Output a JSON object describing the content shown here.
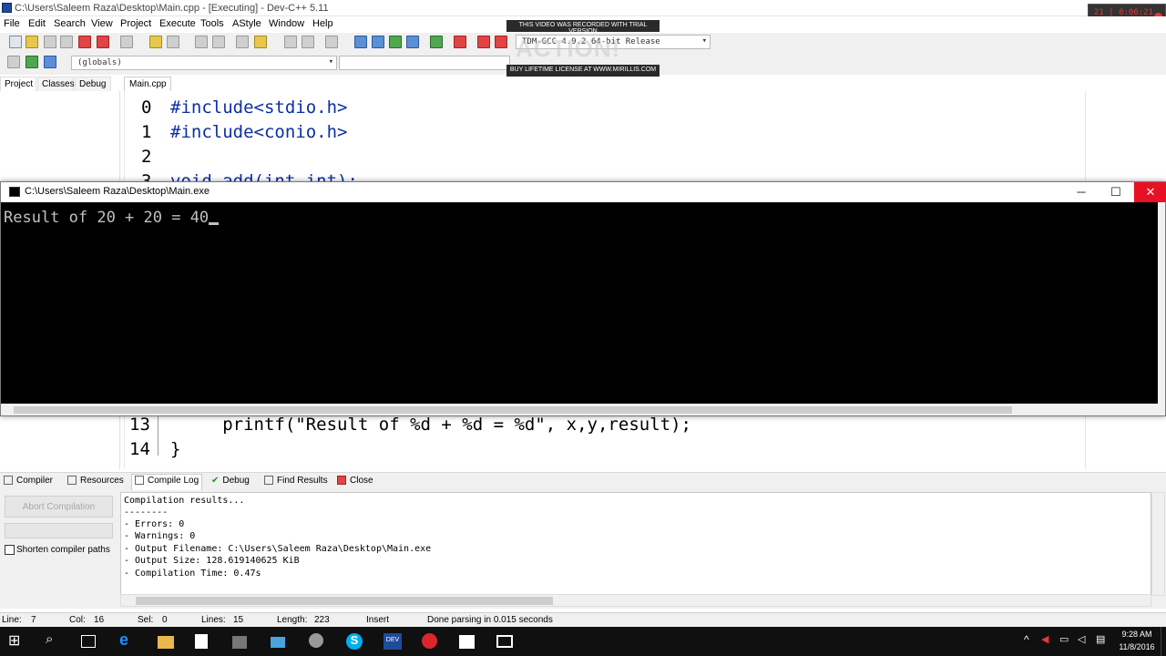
{
  "ide": {
    "title": "C:\\Users\\Saleem Raza\\Desktop\\Main.cpp - [Executing] - Dev-C++ 5.11",
    "menu": [
      "File",
      "Edit",
      "Search",
      "View",
      "Project",
      "Execute",
      "Tools",
      "AStyle",
      "Window",
      "Help"
    ],
    "compiler_combo": "TDM-GCC 4.9.2 64-bit Release",
    "scope_combo": "(globals)",
    "left_tabs": [
      "Project",
      "Classes",
      "Debug"
    ],
    "file_tab": "Main.cpp",
    "code_top": [
      {
        "n": "0",
        "text": "#include<stdio.h>"
      },
      {
        "n": "1",
        "text": "#include<conio.h>"
      },
      {
        "n": "2",
        "text": ""
      },
      {
        "n": "3",
        "text": "void add(int,int);"
      }
    ],
    "code_bottom": [
      {
        "n": "13",
        "text": "     printf(\"Result of %d + %d = %d\", x,y,result);"
      },
      {
        "n": "14",
        "text": "}"
      }
    ]
  },
  "watermark": {
    "top": "THIS VIDEO WAS RECORDED WITH TRIAL VERSION",
    "big": "ACTION!",
    "bottom": "BUY LIFETIME LICENSE AT WWW.MIRILLIS.COM"
  },
  "recorder": {
    "time": "21 ∣ 0:06:21"
  },
  "console": {
    "title": "C:\\Users\\Saleem Raza\\Desktop\\Main.exe",
    "output": "Result of 20 + 20 = 40",
    "min": "─",
    "max": "☐",
    "close": "✕"
  },
  "bottom_tabs": [
    "Compiler",
    "Resources",
    "Compile Log",
    "Debug",
    "Find Results",
    "Close"
  ],
  "compile_panel": {
    "abort_label": "Abort Compilation",
    "shorten_label": "Shorten compiler paths",
    "log": [
      "Compilation results...",
      "--------",
      "- Errors: 0",
      "- Warnings: 0",
      "- Output Filename: C:\\Users\\Saleem Raza\\Desktop\\Main.exe",
      "- Output Size: 128.619140625 KiB",
      "- Compilation Time: 0.47s"
    ]
  },
  "status": {
    "line_label": "Line:",
    "line": "7",
    "col_label": "Col:",
    "col": "16",
    "sel_label": "Sel:",
    "sel": "0",
    "lines_label": "Lines:",
    "lines": "15",
    "length_label": "Length:",
    "length": "223",
    "mode": "Insert",
    "message": "Done parsing in 0.015 seconds"
  },
  "taskbar": {
    "time": "9:28 AM",
    "date": "11/8/2016"
  },
  "colors": {
    "keyword": "#0b2fa5",
    "close_red": "#e81123",
    "console_bg": "#000000"
  }
}
